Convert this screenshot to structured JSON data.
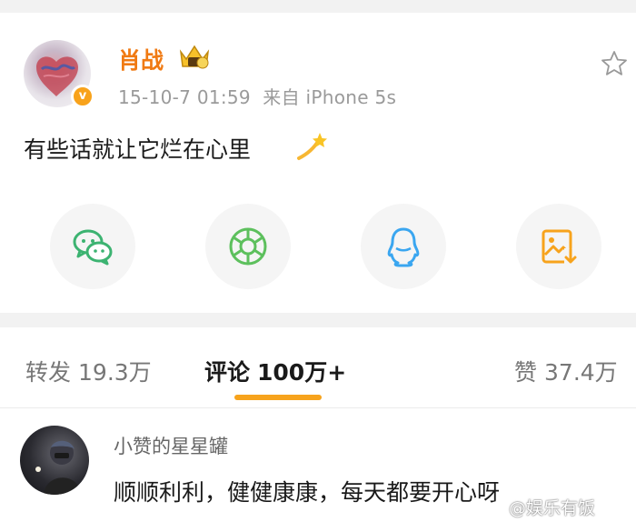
{
  "post": {
    "username": "肖战",
    "timestamp": "15-10-7 01:59",
    "source": "来自 iPhone 5s",
    "verified_badge": "v",
    "content": "有些话就让它烂在心里",
    "icons": {
      "crown": "crown-icon",
      "favorite": "star-icon",
      "content_emoji": "dizzy-star-icon"
    }
  },
  "share": [
    {
      "name": "wechat-share",
      "icon": "wechat-icon",
      "color": "#3cb371"
    },
    {
      "name": "moments-share",
      "icon": "moments-icon",
      "color": "#5dc05d"
    },
    {
      "name": "qq-share",
      "icon": "qq-icon",
      "color": "#3aa6f0"
    },
    {
      "name": "save-image-share",
      "icon": "save-image-icon",
      "color": "#f7a31c"
    }
  ],
  "tabs": {
    "repost": {
      "label": "转发",
      "count": "19.3万"
    },
    "comments": {
      "label": "评论",
      "count": "100万+"
    },
    "likes": {
      "label": "赞",
      "count": "37.4万"
    }
  },
  "comment": {
    "username": "小赞的星星罐",
    "text": "顺顺利利，健健康康，每天都要开心呀"
  },
  "watermark": "@娱乐有饭",
  "colors": {
    "accent": "#f7a31c",
    "username": "#f07a13",
    "meta_gray": "#9a9a9a"
  }
}
